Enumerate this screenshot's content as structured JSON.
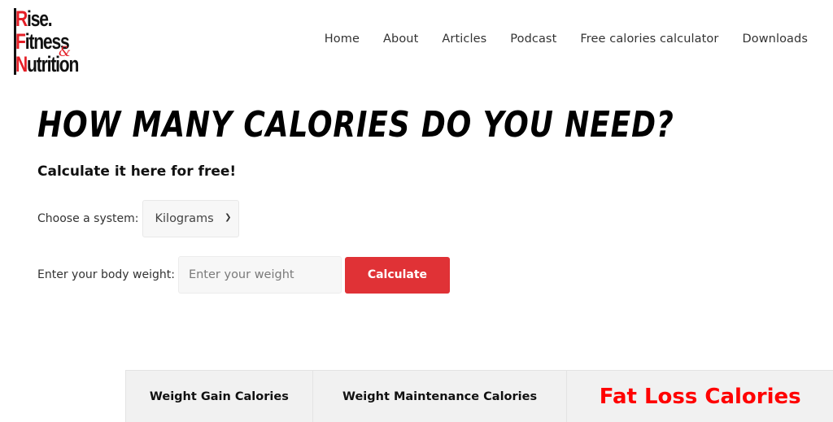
{
  "brand": {
    "lines": [
      {
        "cap": "R",
        "rest": "ise."
      },
      {
        "cap": "F",
        "rest": "itness"
      },
      {
        "cap": "N",
        "rest": "utrition"
      }
    ],
    "ampersand": "&",
    "accent_color": "#e41e26"
  },
  "nav": {
    "items": [
      "Home",
      "About",
      "Articles",
      "Podcast",
      "Free calories calculator",
      "Downloads"
    ]
  },
  "main": {
    "title": "HOW MANY CALORIES DO YOU NEED?",
    "subtitle": "Calculate it here for free!",
    "system_label": "Choose a system:",
    "system_selected": "Kilograms",
    "weight_label": "Enter your body weight:",
    "weight_value": "",
    "weight_placeholder": "Enter your weight",
    "calculate_label": "Calculate",
    "button_color": "#e03236"
  },
  "tabs": {
    "items": [
      "Weight Gain Calories",
      "Weight Maintenance Calories",
      "Fat Loss Calories"
    ],
    "active_index": 2,
    "active_color": "#ff0000"
  }
}
